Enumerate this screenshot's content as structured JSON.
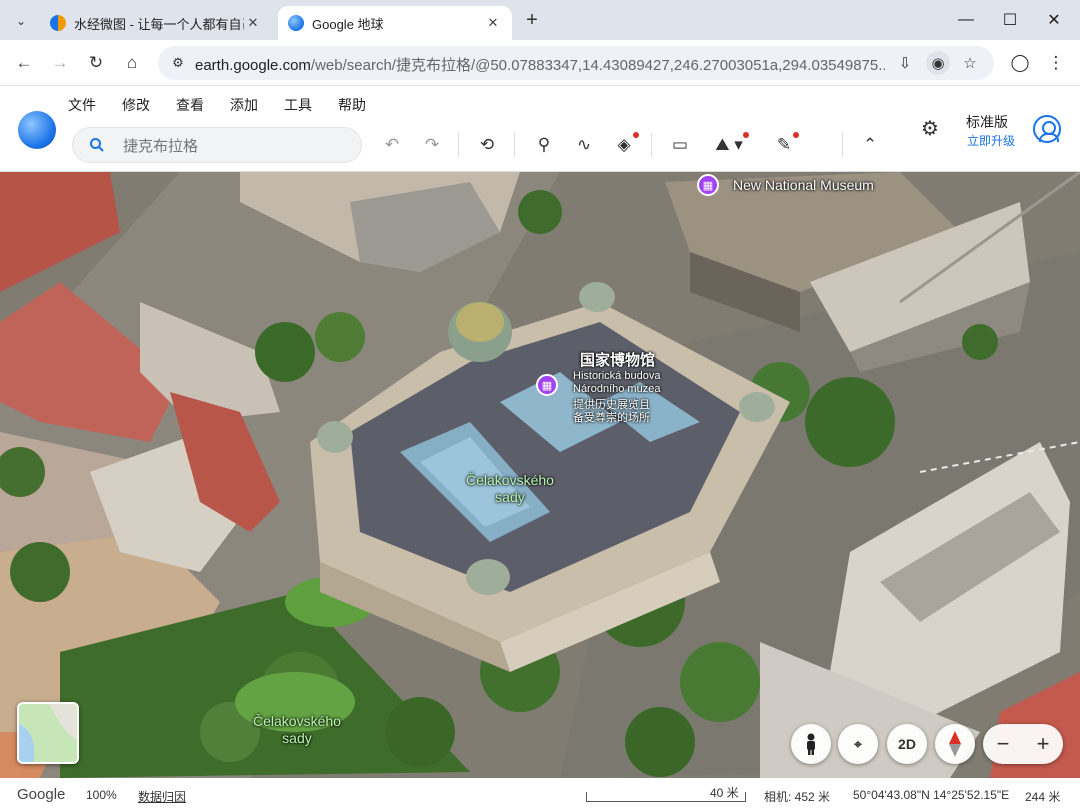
{
  "browser": {
    "tabs": [
      {
        "title": "水经微图 - 让每一个人都有自己",
        "active": false
      },
      {
        "title": "Google 地球",
        "active": true
      }
    ],
    "address": {
      "host": "earth.google.com",
      "path": "/web/search/捷克布拉格/@50.07883347,14.43089427,246.27003051a,294.03549875..."
    }
  },
  "app": {
    "menu": [
      "文件",
      "修改",
      "查看",
      "添加",
      "工具",
      "帮助"
    ],
    "search": {
      "placeholder": "捷克布拉格"
    },
    "plan": {
      "label": "标准版",
      "upgrade": "立即升级"
    }
  },
  "map": {
    "labels": {
      "new_museum": "New National Museum",
      "museum_title": "国家博物馆",
      "museum_sub1": "Historická budova",
      "museum_sub2": "Národního muzea",
      "museum_sub3": "提供历史展览且",
      "museum_sub4": "备受尊崇的场所",
      "park_roof_1": "Čelakovského",
      "park_roof_2": "sady",
      "park_bottom_1": "Čelakovského",
      "park_bottom_2": "sady"
    },
    "controls": {
      "mode_2d": "2D"
    }
  },
  "status": {
    "brand": "Google",
    "loaded": "100%",
    "attribution": "数据归因",
    "scale": "40 米",
    "camera": "相机: 452 米",
    "coordinates": "50°04'43.08\"N 14°25'52.15\"E",
    "elevation": "244 米"
  },
  "colors": {
    "accent": "#1a73e8",
    "poi": "#a142f4",
    "alert_dot": "#d93025"
  }
}
